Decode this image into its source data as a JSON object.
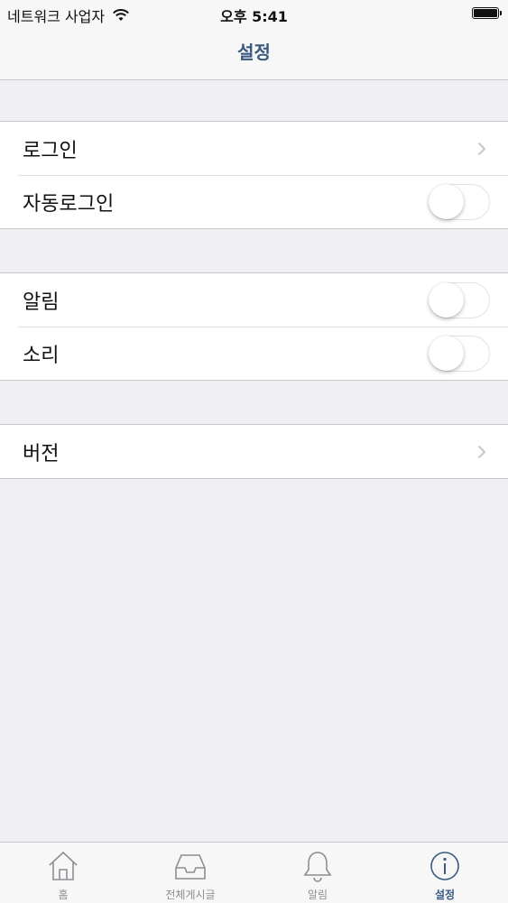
{
  "status_bar": {
    "carrier": "네트워크 사업자",
    "time": "오후 5:41"
  },
  "nav": {
    "title": "설정"
  },
  "groups": [
    {
      "rows": [
        {
          "label": "로그인",
          "accessory": "chevron"
        },
        {
          "label": "자동로그인",
          "accessory": "toggle",
          "on": false
        }
      ]
    },
    {
      "rows": [
        {
          "label": "알림",
          "accessory": "toggle",
          "on": false
        },
        {
          "label": "소리",
          "accessory": "toggle",
          "on": false
        }
      ]
    },
    {
      "rows": [
        {
          "label": "버전",
          "accessory": "chevron"
        }
      ]
    }
  ],
  "tab_bar": {
    "tabs": [
      {
        "label": "홈",
        "icon": "home-icon"
      },
      {
        "label": "전체게시글",
        "icon": "inbox-icon"
      },
      {
        "label": "알림",
        "icon": "bell-icon"
      },
      {
        "label": "설정",
        "icon": "info-icon",
        "active": true
      }
    ]
  },
  "colors": {
    "accent": "#3a5a80",
    "background": "#efeff4"
  }
}
